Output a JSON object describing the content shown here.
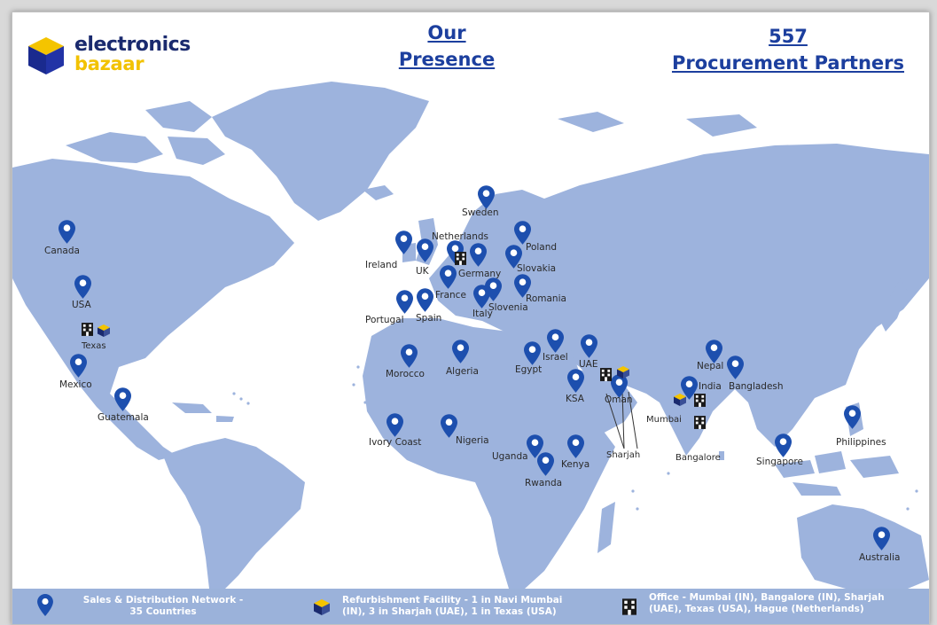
{
  "header": {
    "logo_line1": "electronics",
    "logo_line2": "bazaar",
    "presence_line1": "Our",
    "presence_line2": "Presence",
    "partners_count": "557",
    "partners_label": "Procurement Partners"
  },
  "countries": [
    {
      "name": "Canada"
    },
    {
      "name": "USA"
    },
    {
      "name": "Texas"
    },
    {
      "name": "Mexico"
    },
    {
      "name": "Guatemala"
    },
    {
      "name": "Sweden"
    },
    {
      "name": "Netherlands"
    },
    {
      "name": "Poland"
    },
    {
      "name": "Ireland"
    },
    {
      "name": "UK"
    },
    {
      "name": "Germany"
    },
    {
      "name": "Slovakia"
    },
    {
      "name": "France"
    },
    {
      "name": "Portugal"
    },
    {
      "name": "Spain"
    },
    {
      "name": "Italy"
    },
    {
      "name": "Slovenia"
    },
    {
      "name": "Romania"
    },
    {
      "name": "Morocco"
    },
    {
      "name": "Algeria"
    },
    {
      "name": "Egypt"
    },
    {
      "name": "Israel"
    },
    {
      "name": "UAE"
    },
    {
      "name": "KSA"
    },
    {
      "name": "Oman"
    },
    {
      "name": "Nepal"
    },
    {
      "name": "India"
    },
    {
      "name": "Bangladesh"
    },
    {
      "name": "Mumbai"
    },
    {
      "name": "Bangalore"
    },
    {
      "name": "Sharjah"
    },
    {
      "name": "Ivory Coast"
    },
    {
      "name": "Nigeria"
    },
    {
      "name": "Uganda"
    },
    {
      "name": "Kenya"
    },
    {
      "name": "Rwanda"
    },
    {
      "name": "Singapore"
    },
    {
      "name": "Philippines"
    },
    {
      "name": "Australia"
    }
  ],
  "legend": {
    "sales_line1": "Sales & Distribution Network -",
    "sales_line2": "35 Countries",
    "refurb_line1": "Refurbishment Facility - 1 in Navi Mumbai",
    "refurb_line2": "(IN), 3 in Sharjah (UAE), 1 in Texas (USA)",
    "office_line1": "Office - Mumbai (IN), Bangalore (IN), Sharjah",
    "office_line2": "(UAE), Texas (USA), Hague (Netherlands)"
  },
  "icons": {
    "pin": "map-pin-icon",
    "refurb": "refurbishment-cube-icon",
    "office": "office-building-icon"
  },
  "colors": {
    "pin": "#1d4fae",
    "land": "#9db3dd",
    "title": "#1c3f9e",
    "logo_blue": "#1a2a6e",
    "logo_yellow": "#f2c200",
    "legend_bar": "#9bb2da"
  }
}
